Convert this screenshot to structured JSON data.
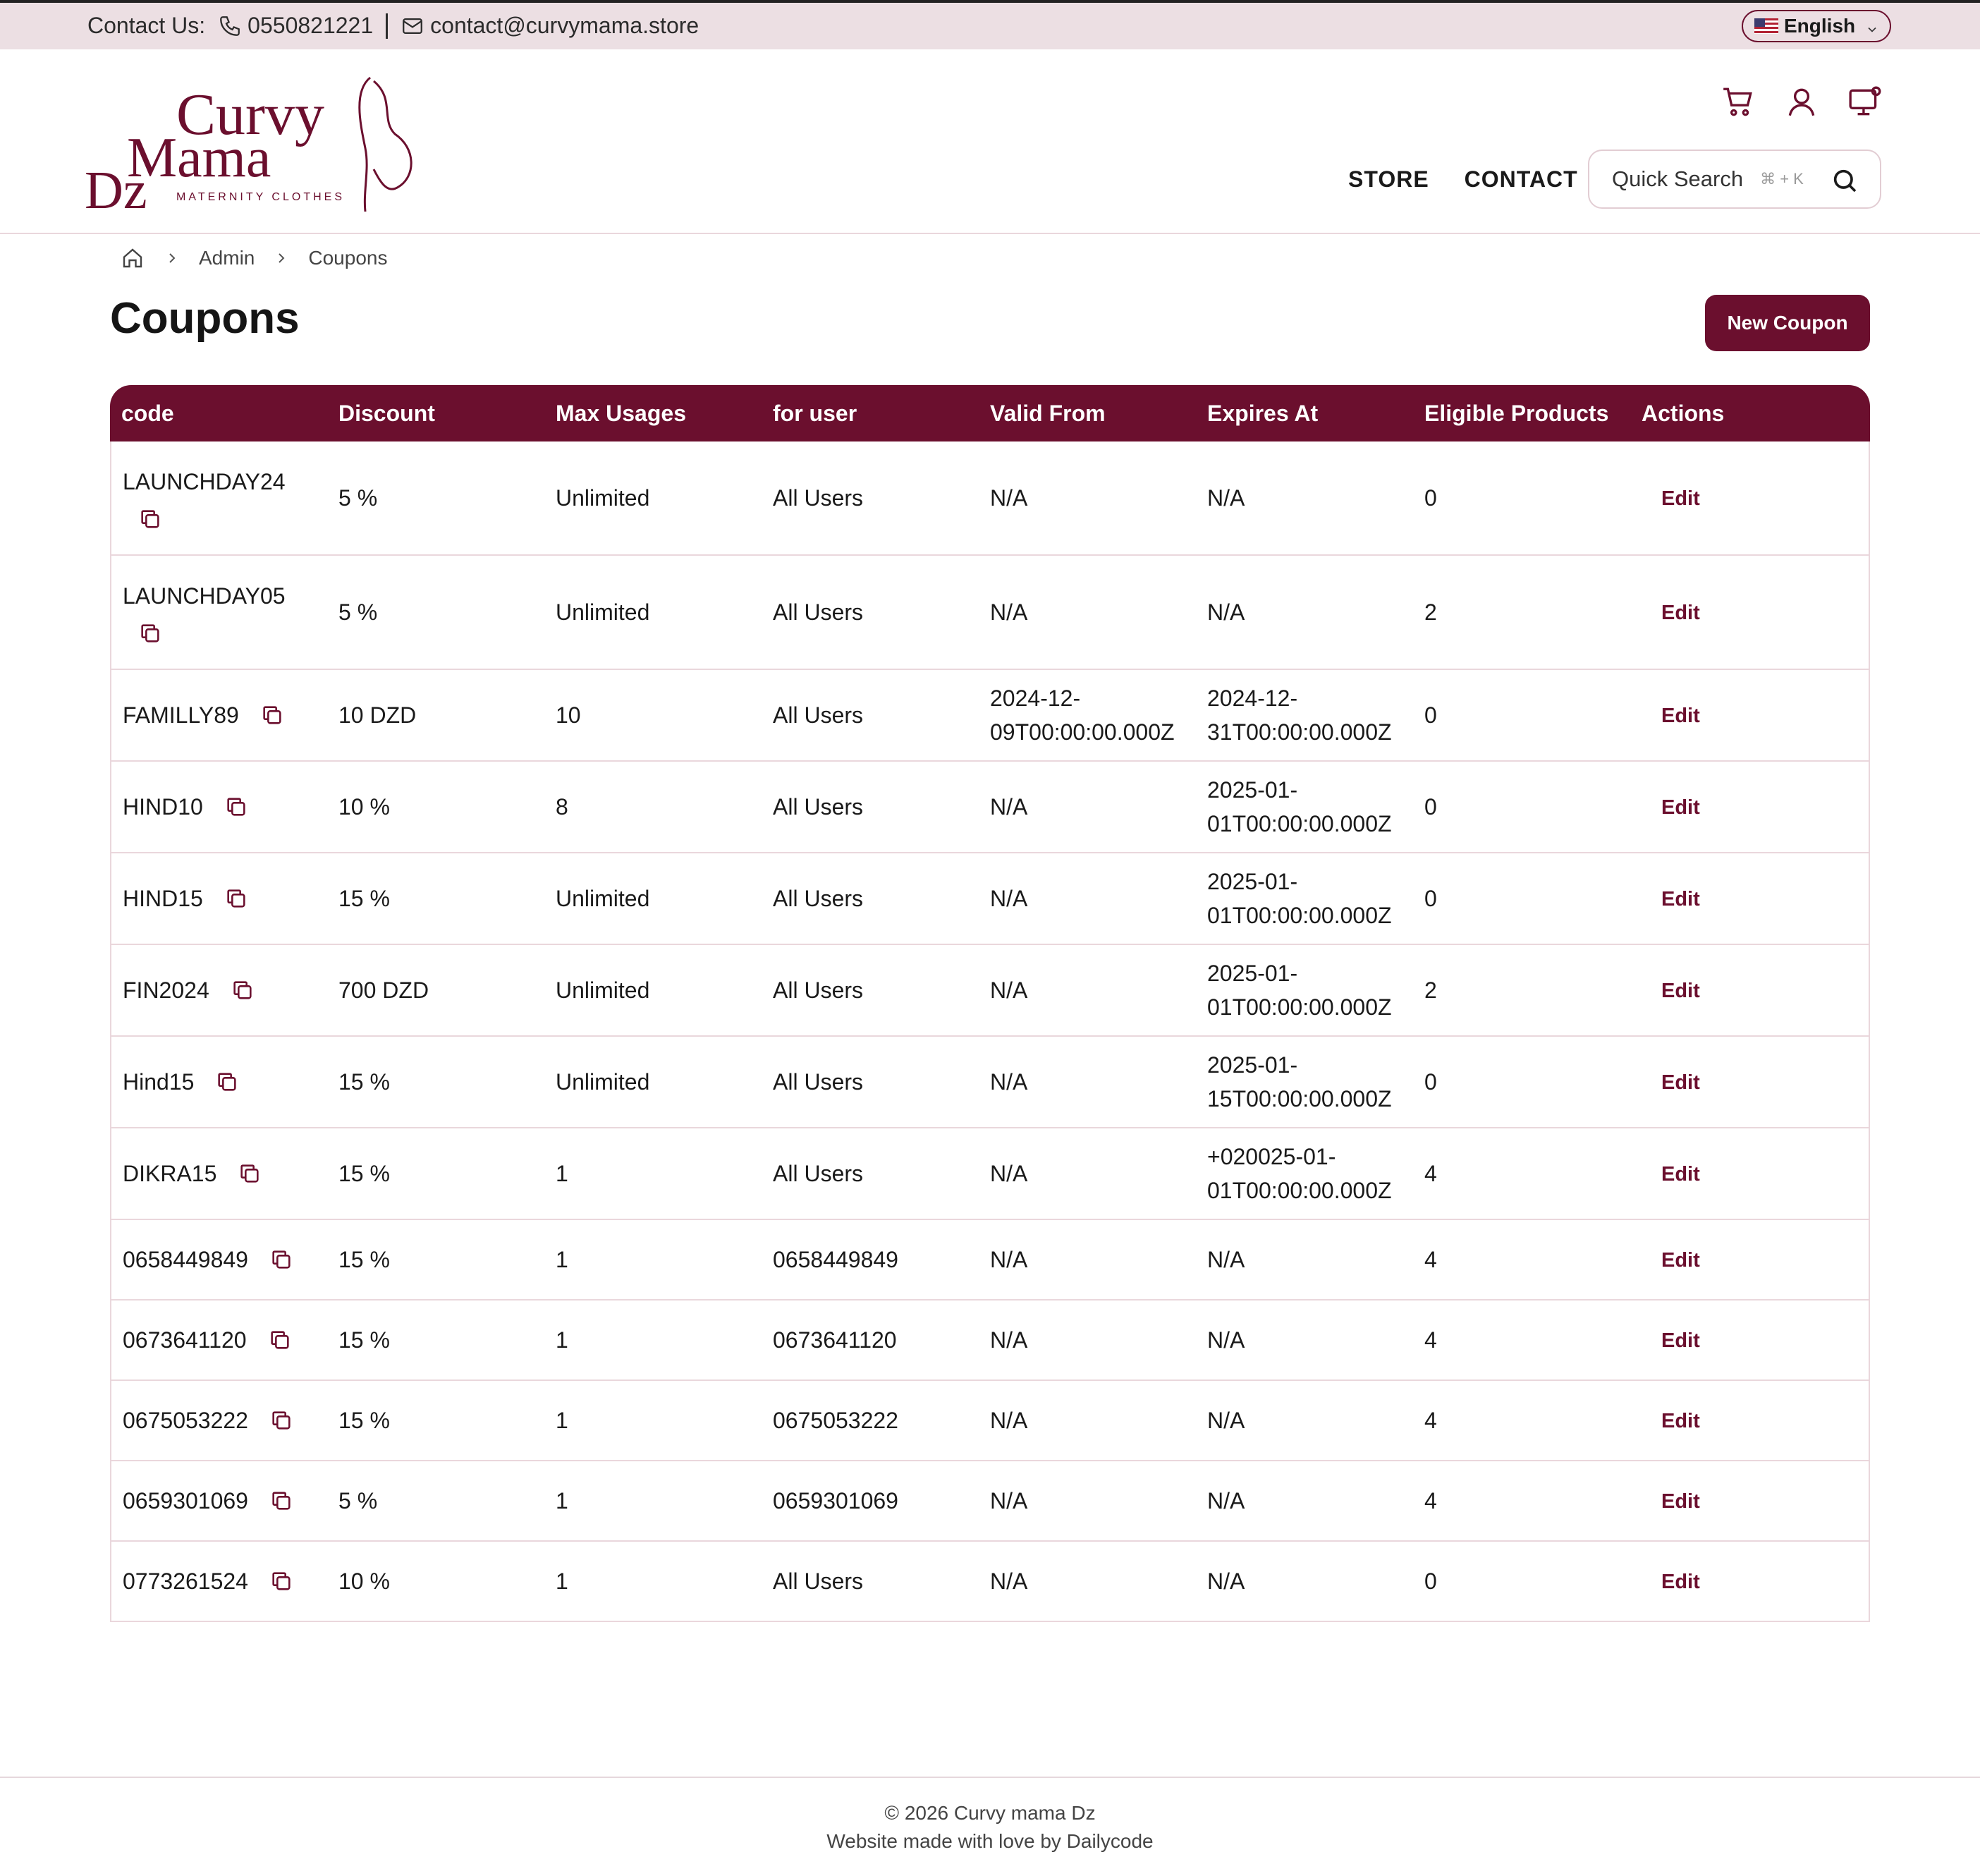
{
  "topbar": {
    "contact_label": "Contact Us:",
    "phone": "0550821221",
    "email": "contact@curvymama.store",
    "language": "English"
  },
  "brand": {
    "line1": "Curvy",
    "line2": "Mama",
    "line3": "Dz",
    "tagline": "MATERNITY CLOTHES",
    "color": "#6b0f2e"
  },
  "nav": {
    "store": "STORE",
    "contact": "CONTACT"
  },
  "search": {
    "placeholder": "Quick Search",
    "shortcut": "⌘ + K"
  },
  "breadcrumb": {
    "admin": "Admin",
    "current": "Coupons"
  },
  "page": {
    "title": "Coupons",
    "new_button": "New Coupon"
  },
  "table": {
    "headers": [
      "code",
      "Discount",
      "Max Usages",
      "for user",
      "Valid From",
      "Expires At",
      "Eligible Products",
      "Actions"
    ],
    "edit_label": "Edit",
    "rows": [
      {
        "code": "LAUNCHDAY24",
        "discount": "5 %",
        "max": "Unlimited",
        "user": "All Users",
        "from_a": "N/A",
        "from_b": "",
        "exp_a": "N/A",
        "exp_b": "",
        "products": "0"
      },
      {
        "code": "LAUNCHDAY05",
        "discount": "5 %",
        "max": "Unlimited",
        "user": "All Users",
        "from_a": "N/A",
        "from_b": "",
        "exp_a": "N/A",
        "exp_b": "",
        "products": "2"
      },
      {
        "code": "FAMILLY89",
        "discount": "10 DZD",
        "max": "10",
        "user": "All Users",
        "from_a": "2024-12-",
        "from_b": "09T00:00:00.000Z",
        "exp_a": "2024-12-",
        "exp_b": "31T00:00:00.000Z",
        "products": "0"
      },
      {
        "code": "HIND10",
        "discount": "10 %",
        "max": "8",
        "user": "All Users",
        "from_a": "N/A",
        "from_b": "",
        "exp_a": "2025-01-",
        "exp_b": "01T00:00:00.000Z",
        "products": "0"
      },
      {
        "code": "HIND15",
        "discount": "15 %",
        "max": "Unlimited",
        "user": "All Users",
        "from_a": "N/A",
        "from_b": "",
        "exp_a": "2025-01-",
        "exp_b": "01T00:00:00.000Z",
        "products": "0"
      },
      {
        "code": "FIN2024",
        "discount": "700 DZD",
        "max": "Unlimited",
        "user": "All Users",
        "from_a": "N/A",
        "from_b": "",
        "exp_a": "2025-01-",
        "exp_b": "01T00:00:00.000Z",
        "products": "2"
      },
      {
        "code": "Hind15",
        "discount": "15 %",
        "max": "Unlimited",
        "user": "All Users",
        "from_a": "N/A",
        "from_b": "",
        "exp_a": "2025-01-",
        "exp_b": "15T00:00:00.000Z",
        "products": "0"
      },
      {
        "code": "DIKRA15",
        "discount": "15 %",
        "max": "1",
        "user": "All Users",
        "from_a": "N/A",
        "from_b": "",
        "exp_a": "+020025-01-",
        "exp_b": "01T00:00:00.000Z",
        "products": "4"
      },
      {
        "code": "0658449849",
        "discount": "15 %",
        "max": "1",
        "user": "0658449849",
        "from_a": "N/A",
        "from_b": "",
        "exp_a": "N/A",
        "exp_b": "",
        "products": "4"
      },
      {
        "code": "0673641120",
        "discount": "15 %",
        "max": "1",
        "user": "0673641120",
        "from_a": "N/A",
        "from_b": "",
        "exp_a": "N/A",
        "exp_b": "",
        "products": "4"
      },
      {
        "code": "0675053222",
        "discount": "15 %",
        "max": "1",
        "user": "0675053222",
        "from_a": "N/A",
        "from_b": "",
        "exp_a": "N/A",
        "exp_b": "",
        "products": "4"
      },
      {
        "code": "0659301069",
        "discount": "5 %",
        "max": "1",
        "user": "0659301069",
        "from_a": "N/A",
        "from_b": "",
        "exp_a": "N/A",
        "exp_b": "",
        "products": "4"
      },
      {
        "code": "0773261524",
        "discount": "10 %",
        "max": "1",
        "user": "All Users",
        "from_a": "N/A",
        "from_b": "",
        "exp_a": "N/A",
        "exp_b": "",
        "products": "0"
      }
    ]
  },
  "footer": {
    "copyright": "© 2026 Curvy mama Dz",
    "credit": "Website made with love by Dailycode"
  }
}
